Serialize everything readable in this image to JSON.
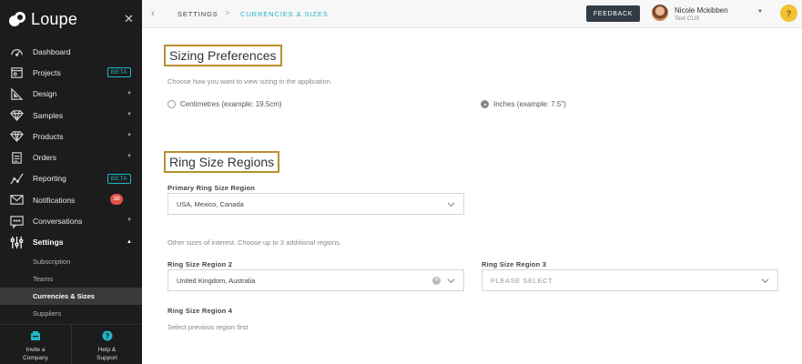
{
  "app": {
    "logo_text": "Loupe"
  },
  "sidebar": {
    "items": [
      {
        "label": "Dashboard",
        "icon": "dashboard-icon"
      },
      {
        "label": "Projects",
        "icon": "projects-icon",
        "badge": "BETA"
      },
      {
        "label": "Design",
        "icon": "design-icon"
      },
      {
        "label": "Samples",
        "icon": "samples-icon"
      },
      {
        "label": "Products",
        "icon": "products-icon"
      },
      {
        "label": "Orders",
        "icon": "orders-icon"
      },
      {
        "label": "Reporting",
        "icon": "reporting-icon",
        "badge": "BETA"
      },
      {
        "label": "Notifications",
        "icon": "notifications-icon",
        "count": "38"
      },
      {
        "label": "Conversations",
        "icon": "conversations-icon"
      },
      {
        "label": "Settings",
        "icon": "settings-icon"
      }
    ],
    "settings_sub": [
      {
        "label": "Subscription"
      },
      {
        "label": "Teams"
      },
      {
        "label": "Currencies & Sizes"
      },
      {
        "label": "Suppliers"
      }
    ],
    "bottom": {
      "invite_line1": "Invite a",
      "invite_line2": "Company",
      "help_line1": "Help &",
      "help_line2": "Support"
    }
  },
  "topbar": {
    "breadcrumb_1": "SETTINGS",
    "breadcrumb_sep": ">",
    "breadcrumb_2": "CURRENCIES & SIZES",
    "feedback_label": "FEEDBACK",
    "user_name": "Nicole Mckibben",
    "user_company": "Test CUS",
    "help_label": "?"
  },
  "sizing": {
    "title": "Sizing Preferences",
    "hint": "Choose how you want to view sizing in the application.",
    "option_cm": "Centimetres (example: 19.5cm)",
    "option_in": "Inches (example: 7.5\")",
    "selected": "inches"
  },
  "ring": {
    "title": "Ring Size Regions",
    "primary_label": "Primary Ring Size Region",
    "primary_value": "USA, Mexico, Canada",
    "other_hint": "Other sizes of interest. Choose up to 3 additional regions.",
    "region2_label": "Ring Size Region 2",
    "region2_value": "United Kingdom, Australia",
    "region3_label": "Ring Size Region 3",
    "region3_placeholder": "PLEASE SELECT",
    "region4_label": "Ring Size Region 4",
    "region4_hint": "Select previous region first"
  },
  "colors": {
    "sidebar_bg": "#1c1c1c",
    "accent": "#1fb6c9",
    "title_border": "#b8902f",
    "feedback_bg": "#333c45",
    "help_bg": "#f1c232",
    "badge_red": "#e15249"
  }
}
